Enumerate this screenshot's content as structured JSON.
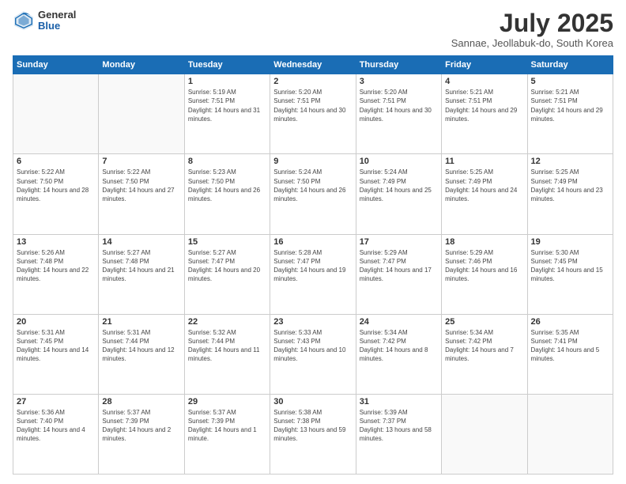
{
  "header": {
    "logo_general": "General",
    "logo_blue": "Blue",
    "month_title": "July 2025",
    "location": "Sannae, Jeollabuk-do, South Korea"
  },
  "weekdays": [
    "Sunday",
    "Monday",
    "Tuesday",
    "Wednesday",
    "Thursday",
    "Friday",
    "Saturday"
  ],
  "weeks": [
    [
      {
        "day": "",
        "sunrise": "",
        "sunset": "",
        "daylight": ""
      },
      {
        "day": "",
        "sunrise": "",
        "sunset": "",
        "daylight": ""
      },
      {
        "day": "1",
        "sunrise": "Sunrise: 5:19 AM",
        "sunset": "Sunset: 7:51 PM",
        "daylight": "Daylight: 14 hours and 31 minutes."
      },
      {
        "day": "2",
        "sunrise": "Sunrise: 5:20 AM",
        "sunset": "Sunset: 7:51 PM",
        "daylight": "Daylight: 14 hours and 30 minutes."
      },
      {
        "day": "3",
        "sunrise": "Sunrise: 5:20 AM",
        "sunset": "Sunset: 7:51 PM",
        "daylight": "Daylight: 14 hours and 30 minutes."
      },
      {
        "day": "4",
        "sunrise": "Sunrise: 5:21 AM",
        "sunset": "Sunset: 7:51 PM",
        "daylight": "Daylight: 14 hours and 29 minutes."
      },
      {
        "day": "5",
        "sunrise": "Sunrise: 5:21 AM",
        "sunset": "Sunset: 7:51 PM",
        "daylight": "Daylight: 14 hours and 29 minutes."
      }
    ],
    [
      {
        "day": "6",
        "sunrise": "Sunrise: 5:22 AM",
        "sunset": "Sunset: 7:50 PM",
        "daylight": "Daylight: 14 hours and 28 minutes."
      },
      {
        "day": "7",
        "sunrise": "Sunrise: 5:22 AM",
        "sunset": "Sunset: 7:50 PM",
        "daylight": "Daylight: 14 hours and 27 minutes."
      },
      {
        "day": "8",
        "sunrise": "Sunrise: 5:23 AM",
        "sunset": "Sunset: 7:50 PM",
        "daylight": "Daylight: 14 hours and 26 minutes."
      },
      {
        "day": "9",
        "sunrise": "Sunrise: 5:24 AM",
        "sunset": "Sunset: 7:50 PM",
        "daylight": "Daylight: 14 hours and 26 minutes."
      },
      {
        "day": "10",
        "sunrise": "Sunrise: 5:24 AM",
        "sunset": "Sunset: 7:49 PM",
        "daylight": "Daylight: 14 hours and 25 minutes."
      },
      {
        "day": "11",
        "sunrise": "Sunrise: 5:25 AM",
        "sunset": "Sunset: 7:49 PM",
        "daylight": "Daylight: 14 hours and 24 minutes."
      },
      {
        "day": "12",
        "sunrise": "Sunrise: 5:25 AM",
        "sunset": "Sunset: 7:49 PM",
        "daylight": "Daylight: 14 hours and 23 minutes."
      }
    ],
    [
      {
        "day": "13",
        "sunrise": "Sunrise: 5:26 AM",
        "sunset": "Sunset: 7:48 PM",
        "daylight": "Daylight: 14 hours and 22 minutes."
      },
      {
        "day": "14",
        "sunrise": "Sunrise: 5:27 AM",
        "sunset": "Sunset: 7:48 PM",
        "daylight": "Daylight: 14 hours and 21 minutes."
      },
      {
        "day": "15",
        "sunrise": "Sunrise: 5:27 AM",
        "sunset": "Sunset: 7:47 PM",
        "daylight": "Daylight: 14 hours and 20 minutes."
      },
      {
        "day": "16",
        "sunrise": "Sunrise: 5:28 AM",
        "sunset": "Sunset: 7:47 PM",
        "daylight": "Daylight: 14 hours and 19 minutes."
      },
      {
        "day": "17",
        "sunrise": "Sunrise: 5:29 AM",
        "sunset": "Sunset: 7:47 PM",
        "daylight": "Daylight: 14 hours and 17 minutes."
      },
      {
        "day": "18",
        "sunrise": "Sunrise: 5:29 AM",
        "sunset": "Sunset: 7:46 PM",
        "daylight": "Daylight: 14 hours and 16 minutes."
      },
      {
        "day": "19",
        "sunrise": "Sunrise: 5:30 AM",
        "sunset": "Sunset: 7:45 PM",
        "daylight": "Daylight: 14 hours and 15 minutes."
      }
    ],
    [
      {
        "day": "20",
        "sunrise": "Sunrise: 5:31 AM",
        "sunset": "Sunset: 7:45 PM",
        "daylight": "Daylight: 14 hours and 14 minutes."
      },
      {
        "day": "21",
        "sunrise": "Sunrise: 5:31 AM",
        "sunset": "Sunset: 7:44 PM",
        "daylight": "Daylight: 14 hours and 12 minutes."
      },
      {
        "day": "22",
        "sunrise": "Sunrise: 5:32 AM",
        "sunset": "Sunset: 7:44 PM",
        "daylight": "Daylight: 14 hours and 11 minutes."
      },
      {
        "day": "23",
        "sunrise": "Sunrise: 5:33 AM",
        "sunset": "Sunset: 7:43 PM",
        "daylight": "Daylight: 14 hours and 10 minutes."
      },
      {
        "day": "24",
        "sunrise": "Sunrise: 5:34 AM",
        "sunset": "Sunset: 7:42 PM",
        "daylight": "Daylight: 14 hours and 8 minutes."
      },
      {
        "day": "25",
        "sunrise": "Sunrise: 5:34 AM",
        "sunset": "Sunset: 7:42 PM",
        "daylight": "Daylight: 14 hours and 7 minutes."
      },
      {
        "day": "26",
        "sunrise": "Sunrise: 5:35 AM",
        "sunset": "Sunset: 7:41 PM",
        "daylight": "Daylight: 14 hours and 5 minutes."
      }
    ],
    [
      {
        "day": "27",
        "sunrise": "Sunrise: 5:36 AM",
        "sunset": "Sunset: 7:40 PM",
        "daylight": "Daylight: 14 hours and 4 minutes."
      },
      {
        "day": "28",
        "sunrise": "Sunrise: 5:37 AM",
        "sunset": "Sunset: 7:39 PM",
        "daylight": "Daylight: 14 hours and 2 minutes."
      },
      {
        "day": "29",
        "sunrise": "Sunrise: 5:37 AM",
        "sunset": "Sunset: 7:39 PM",
        "daylight": "Daylight: 14 hours and 1 minute."
      },
      {
        "day": "30",
        "sunrise": "Sunrise: 5:38 AM",
        "sunset": "Sunset: 7:38 PM",
        "daylight": "Daylight: 13 hours and 59 minutes."
      },
      {
        "day": "31",
        "sunrise": "Sunrise: 5:39 AM",
        "sunset": "Sunset: 7:37 PM",
        "daylight": "Daylight: 13 hours and 58 minutes."
      },
      {
        "day": "",
        "sunrise": "",
        "sunset": "",
        "daylight": ""
      },
      {
        "day": "",
        "sunrise": "",
        "sunset": "",
        "daylight": ""
      }
    ]
  ]
}
